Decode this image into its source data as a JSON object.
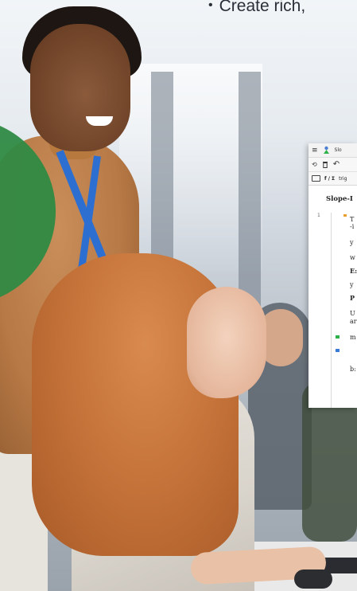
{
  "hero": {
    "bullet": "•",
    "text": "Create rich,"
  },
  "app": {
    "titlebar": {
      "title": "Slo"
    },
    "toolbar": {
      "undo_symbol": "⟲",
      "trash_symbol": "🗑",
      "redo_symbol": "↶"
    },
    "formula_bar": {
      "mode_label": "f / Σ",
      "text": "trig"
    },
    "document": {
      "title": "Slope-I",
      "line_number": "1",
      "rows": [
        {
          "text": "T",
          "bold": false
        },
        {
          "text": "-i",
          "bold": false
        },
        {
          "text": "y",
          "bold": false
        },
        {
          "text": "w",
          "bold": false
        },
        {
          "text": "E:",
          "bold": true
        },
        {
          "text": "y",
          "bold": false
        },
        {
          "text": "P",
          "bold": true
        },
        {
          "text": "U",
          "bold": false
        },
        {
          "text": "ar",
          "bold": false
        },
        {
          "text": "m",
          "bold": false
        },
        {
          "text": "b:",
          "bold": false
        }
      ]
    }
  },
  "colors": {
    "accent_green": "#2f8a43",
    "marker_orange": "#e7a02d",
    "marker_green": "#2fb14a",
    "marker_blue": "#3a7bd5"
  }
}
